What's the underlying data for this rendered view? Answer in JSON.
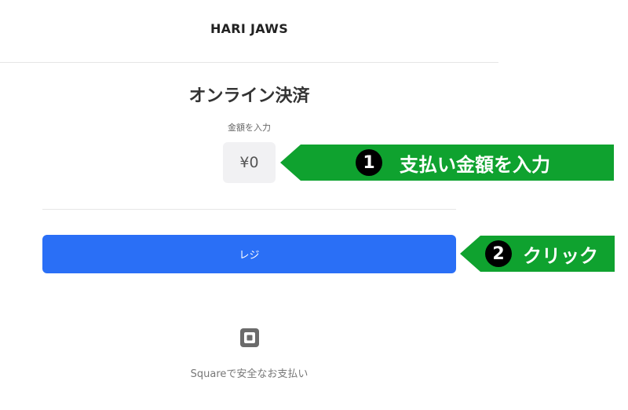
{
  "header": {
    "store_name": "HARI JAWS"
  },
  "main": {
    "title": "オンライン決済",
    "amount_label": "金額を入力",
    "amount_value": "¥0",
    "checkout_button_label": "レジ"
  },
  "footer": {
    "logo_icon": "square-logo-icon",
    "powered_by": "Squareで安全なお支払い"
  },
  "annotations": [
    {
      "number": "1",
      "text": "支払い金額を入力"
    },
    {
      "number": "2",
      "text": "クリック"
    }
  ],
  "colors": {
    "button": "#2a6ff6",
    "callout": "#0fa22f",
    "step_badge": "#000000"
  }
}
